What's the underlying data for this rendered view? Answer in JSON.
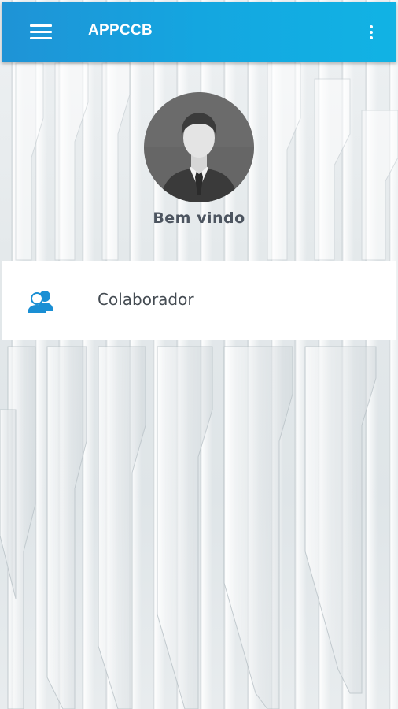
{
  "app": {
    "title": "APPCCB"
  },
  "header": {
    "menu_icon": "hamburger-menu-icon",
    "more_icon": "more-vert-icon"
  },
  "profile": {
    "avatar_icon": "user-avatar",
    "welcome_text": "Bem vindo"
  },
  "menu": {
    "items": [
      {
        "label": "Colaborador",
        "icon": "people-icon"
      }
    ]
  },
  "colors": {
    "appbar_start": "#1f93d6",
    "appbar_end": "#11b3e4",
    "icon_accent": "#1a8fd4",
    "welcome_text": "#4d5560"
  }
}
